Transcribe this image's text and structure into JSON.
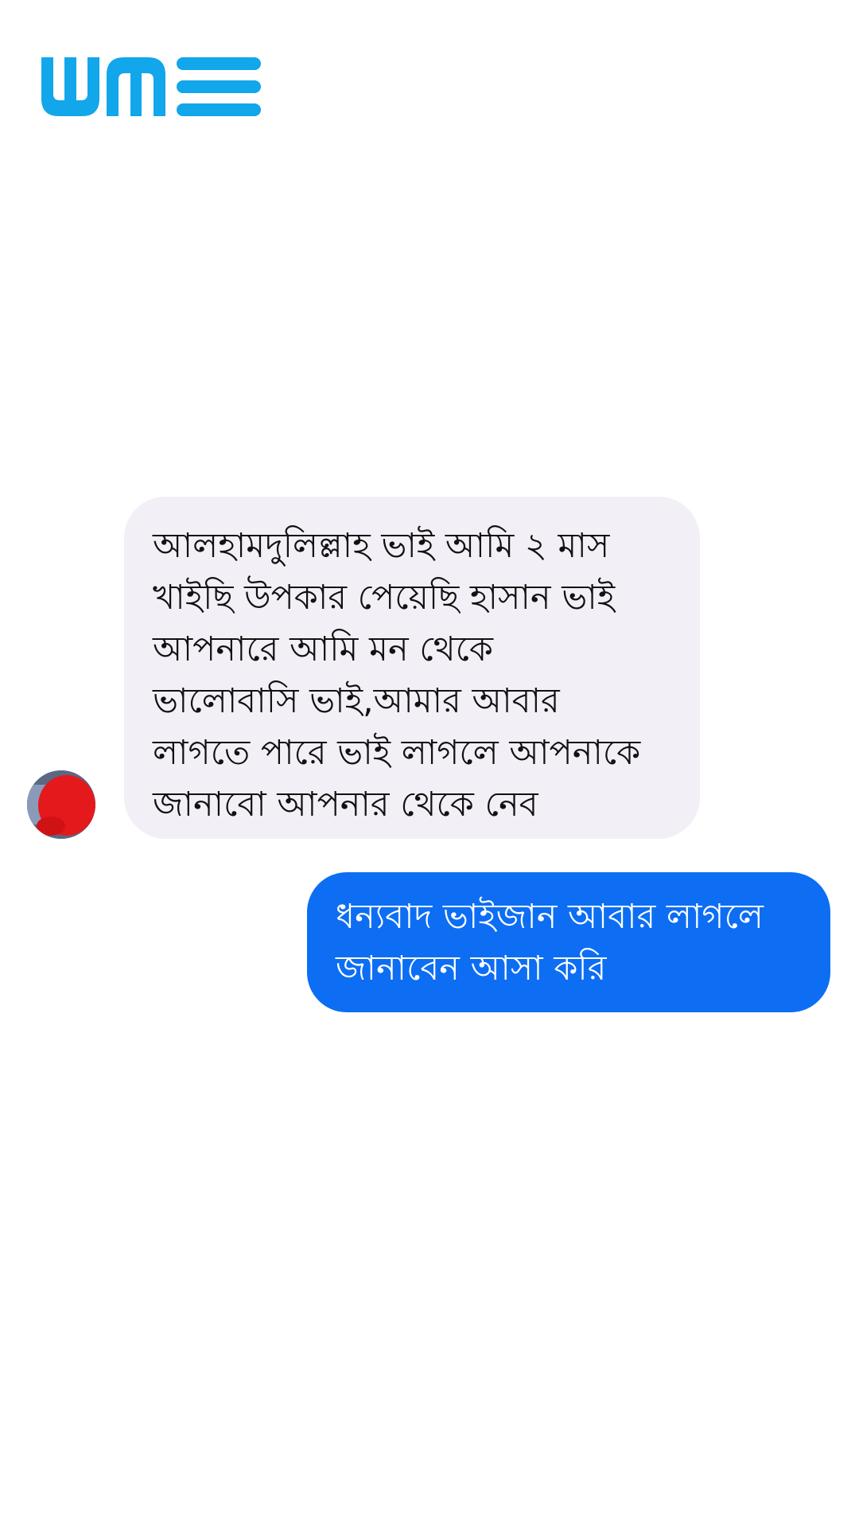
{
  "watermark": {
    "logo_name": "wms-logo",
    "color": "#12a6ea"
  },
  "conversation": {
    "incoming": {
      "avatar_icon": "user-avatar-icon",
      "bubble_color": "#f2eff6",
      "lines": [
        "আলহামদুলিল্লাহ ভাই আমি ২ মাস",
        "খাইছি উপকার পেয়েছি  হাসান ভাই",
        "আপনারে আমি মন থেকে",
        "ভালোবাসি ভাই,আমার আবার",
        "লাগতে পারে ভাই লাগলে আপনাকে",
        "জানাবো আপনার থেকে নেব"
      ]
    },
    "outgoing": {
      "bubble_color": "#0d6ef3",
      "lines": [
        "ধন্যবাদ ভাইজান আবার লাগলে",
        "জানাবেন আসা করি"
      ]
    }
  }
}
